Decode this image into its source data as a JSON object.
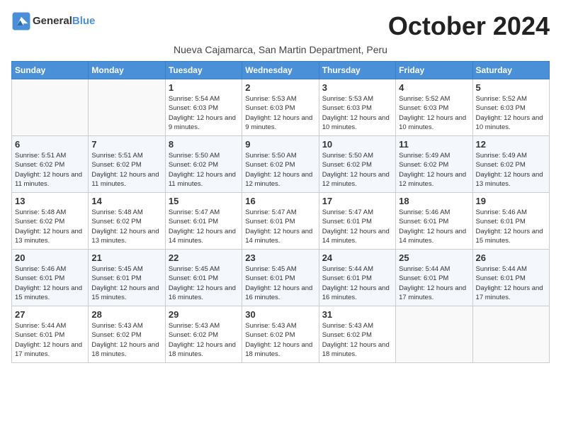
{
  "logo": {
    "line1": "General",
    "line2": "Blue"
  },
  "title": "October 2024",
  "subtitle": "Nueva Cajamarca, San Martin Department, Peru",
  "days_of_week": [
    "Sunday",
    "Monday",
    "Tuesday",
    "Wednesday",
    "Thursday",
    "Friday",
    "Saturday"
  ],
  "weeks": [
    [
      {
        "day": "",
        "info": ""
      },
      {
        "day": "",
        "info": ""
      },
      {
        "day": "1",
        "info": "Sunrise: 5:54 AM\nSunset: 6:03 PM\nDaylight: 12 hours and 9 minutes."
      },
      {
        "day": "2",
        "info": "Sunrise: 5:53 AM\nSunset: 6:03 PM\nDaylight: 12 hours and 9 minutes."
      },
      {
        "day": "3",
        "info": "Sunrise: 5:53 AM\nSunset: 6:03 PM\nDaylight: 12 hours and 10 minutes."
      },
      {
        "day": "4",
        "info": "Sunrise: 5:52 AM\nSunset: 6:03 PM\nDaylight: 12 hours and 10 minutes."
      },
      {
        "day": "5",
        "info": "Sunrise: 5:52 AM\nSunset: 6:03 PM\nDaylight: 12 hours and 10 minutes."
      }
    ],
    [
      {
        "day": "6",
        "info": "Sunrise: 5:51 AM\nSunset: 6:02 PM\nDaylight: 12 hours and 11 minutes."
      },
      {
        "day": "7",
        "info": "Sunrise: 5:51 AM\nSunset: 6:02 PM\nDaylight: 12 hours and 11 minutes."
      },
      {
        "day": "8",
        "info": "Sunrise: 5:50 AM\nSunset: 6:02 PM\nDaylight: 12 hours and 11 minutes."
      },
      {
        "day": "9",
        "info": "Sunrise: 5:50 AM\nSunset: 6:02 PM\nDaylight: 12 hours and 12 minutes."
      },
      {
        "day": "10",
        "info": "Sunrise: 5:50 AM\nSunset: 6:02 PM\nDaylight: 12 hours and 12 minutes."
      },
      {
        "day": "11",
        "info": "Sunrise: 5:49 AM\nSunset: 6:02 PM\nDaylight: 12 hours and 12 minutes."
      },
      {
        "day": "12",
        "info": "Sunrise: 5:49 AM\nSunset: 6:02 PM\nDaylight: 12 hours and 13 minutes."
      }
    ],
    [
      {
        "day": "13",
        "info": "Sunrise: 5:48 AM\nSunset: 6:02 PM\nDaylight: 12 hours and 13 minutes."
      },
      {
        "day": "14",
        "info": "Sunrise: 5:48 AM\nSunset: 6:02 PM\nDaylight: 12 hours and 13 minutes."
      },
      {
        "day": "15",
        "info": "Sunrise: 5:47 AM\nSunset: 6:01 PM\nDaylight: 12 hours and 14 minutes."
      },
      {
        "day": "16",
        "info": "Sunrise: 5:47 AM\nSunset: 6:01 PM\nDaylight: 12 hours and 14 minutes."
      },
      {
        "day": "17",
        "info": "Sunrise: 5:47 AM\nSunset: 6:01 PM\nDaylight: 12 hours and 14 minutes."
      },
      {
        "day": "18",
        "info": "Sunrise: 5:46 AM\nSunset: 6:01 PM\nDaylight: 12 hours and 14 minutes."
      },
      {
        "day": "19",
        "info": "Sunrise: 5:46 AM\nSunset: 6:01 PM\nDaylight: 12 hours and 15 minutes."
      }
    ],
    [
      {
        "day": "20",
        "info": "Sunrise: 5:46 AM\nSunset: 6:01 PM\nDaylight: 12 hours and 15 minutes."
      },
      {
        "day": "21",
        "info": "Sunrise: 5:45 AM\nSunset: 6:01 PM\nDaylight: 12 hours and 15 minutes."
      },
      {
        "day": "22",
        "info": "Sunrise: 5:45 AM\nSunset: 6:01 PM\nDaylight: 12 hours and 16 minutes."
      },
      {
        "day": "23",
        "info": "Sunrise: 5:45 AM\nSunset: 6:01 PM\nDaylight: 12 hours and 16 minutes."
      },
      {
        "day": "24",
        "info": "Sunrise: 5:44 AM\nSunset: 6:01 PM\nDaylight: 12 hours and 16 minutes."
      },
      {
        "day": "25",
        "info": "Sunrise: 5:44 AM\nSunset: 6:01 PM\nDaylight: 12 hours and 17 minutes."
      },
      {
        "day": "26",
        "info": "Sunrise: 5:44 AM\nSunset: 6:01 PM\nDaylight: 12 hours and 17 minutes."
      }
    ],
    [
      {
        "day": "27",
        "info": "Sunrise: 5:44 AM\nSunset: 6:01 PM\nDaylight: 12 hours and 17 minutes."
      },
      {
        "day": "28",
        "info": "Sunrise: 5:43 AM\nSunset: 6:02 PM\nDaylight: 12 hours and 18 minutes."
      },
      {
        "day": "29",
        "info": "Sunrise: 5:43 AM\nSunset: 6:02 PM\nDaylight: 12 hours and 18 minutes."
      },
      {
        "day": "30",
        "info": "Sunrise: 5:43 AM\nSunset: 6:02 PM\nDaylight: 12 hours and 18 minutes."
      },
      {
        "day": "31",
        "info": "Sunrise: 5:43 AM\nSunset: 6:02 PM\nDaylight: 12 hours and 18 minutes."
      },
      {
        "day": "",
        "info": ""
      },
      {
        "day": "",
        "info": ""
      }
    ]
  ]
}
